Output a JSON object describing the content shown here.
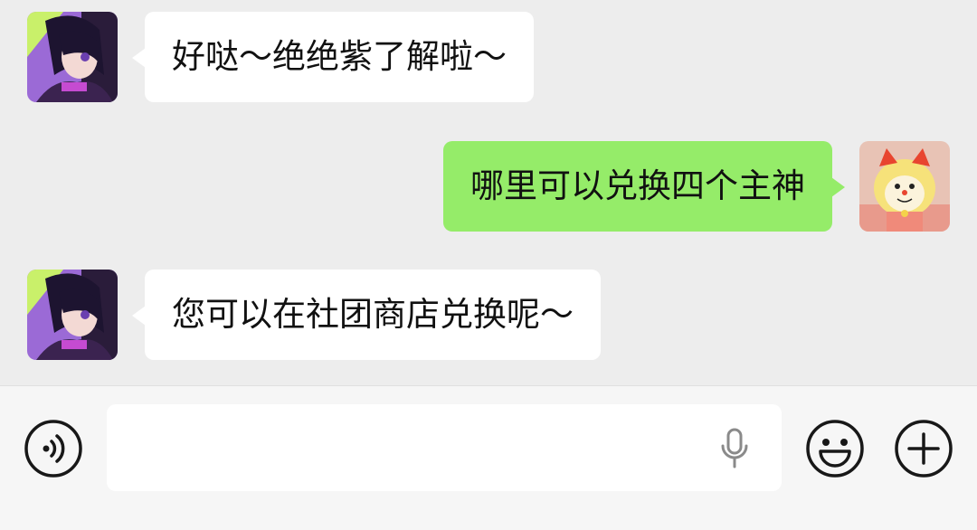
{
  "messages": [
    {
      "side": "left",
      "text": "好哒～绝绝紫了解啦～",
      "avatar": "anime-girl-avatar"
    },
    {
      "side": "right",
      "text": "哪里可以兑换四个主神",
      "avatar": "cartoon-cat-avatar"
    },
    {
      "side": "left",
      "text": "您可以在社团商店兑换呢～",
      "avatar": "anime-girl-avatar"
    }
  ],
  "input": {
    "value": "",
    "placeholder": ""
  },
  "icons": {
    "voice": "voice-mode-icon",
    "mic": "microphone-icon",
    "emoji": "emoji-icon",
    "plus": "plus-icon"
  },
  "colors": {
    "background": "#ededed",
    "incoming_bubble": "#ffffff",
    "outgoing_bubble": "#95ec69",
    "input_bar": "#f6f6f6"
  }
}
